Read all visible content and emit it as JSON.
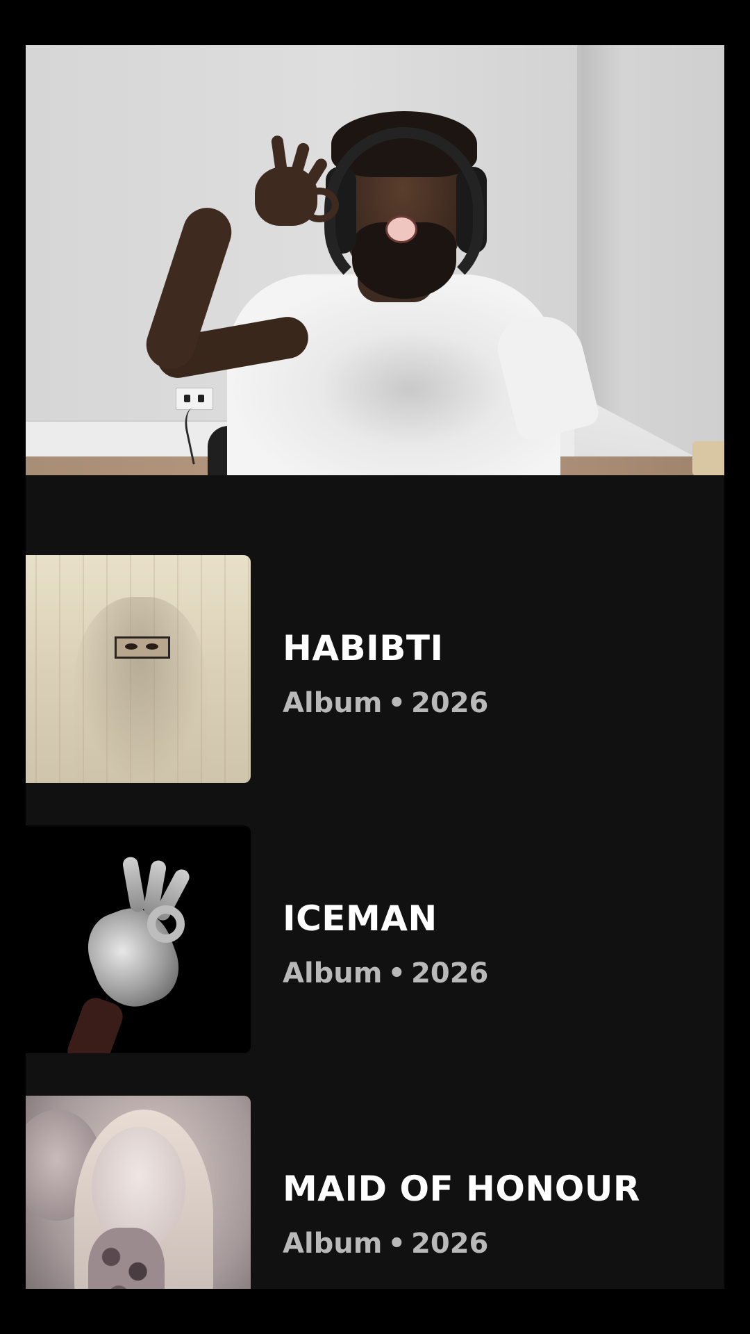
{
  "video": {
    "description_icon": "webcam-video-frame"
  },
  "albums": [
    {
      "title": "HABIBTI",
      "type": "Album",
      "separator": "•",
      "year": "2026"
    },
    {
      "title": "ICEMAN",
      "type": "Album",
      "separator": "•",
      "year": "2026"
    },
    {
      "title": "MAID OF HONOUR",
      "type": "Album",
      "separator": "•",
      "year": "2026"
    }
  ],
  "colors": {
    "background": "#000000",
    "panel": "#111112",
    "title_text": "#ffffff",
    "meta_text": "#b9b9b9"
  }
}
